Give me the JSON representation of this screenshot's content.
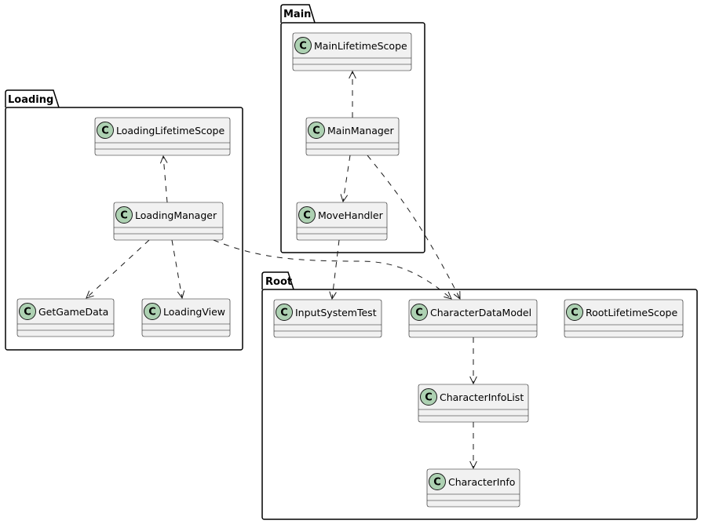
{
  "diagram": {
    "type": "uml-class-diagram",
    "packages": [
      {
        "id": "loading",
        "label": "Loading"
      },
      {
        "id": "main",
        "label": "Main"
      },
      {
        "id": "root",
        "label": "Root"
      }
    ],
    "classes": [
      {
        "id": "LoadingLifetimeScope",
        "label": "LoadingLifetimeScope",
        "package": "Loading",
        "stereotype_icon": "C"
      },
      {
        "id": "LoadingManager",
        "label": "LoadingManager",
        "package": "Loading",
        "stereotype_icon": "C"
      },
      {
        "id": "GetGameData",
        "label": "GetGameData",
        "package": "Loading",
        "stereotype_icon": "C"
      },
      {
        "id": "LoadingView",
        "label": "LoadingView",
        "package": "Loading",
        "stereotype_icon": "C"
      },
      {
        "id": "MainLifetimeScope",
        "label": "MainLifetimeScope",
        "package": "Main",
        "stereotype_icon": "C"
      },
      {
        "id": "MainManager",
        "label": "MainManager",
        "package": "Main",
        "stereotype_icon": "C"
      },
      {
        "id": "MoveHandler",
        "label": "MoveHandler",
        "package": "Main",
        "stereotype_icon": "C"
      },
      {
        "id": "InputSystemTest",
        "label": "InputSystemTest",
        "package": "Root",
        "stereotype_icon": "C"
      },
      {
        "id": "CharacterDataModel",
        "label": "CharacterDataModel",
        "package": "Root",
        "stereotype_icon": "C"
      },
      {
        "id": "RootLifetimeScope",
        "label": "RootLifetimeScope",
        "package": "Root",
        "stereotype_icon": "C"
      },
      {
        "id": "CharacterInfoList",
        "label": "CharacterInfoList",
        "package": "Root",
        "stereotype_icon": "C"
      },
      {
        "id": "CharacterInfo",
        "label": "CharacterInfo",
        "package": "Root",
        "stereotype_icon": "C"
      }
    ],
    "dependencies": [
      {
        "from": "LoadingManager",
        "to": "LoadingLifetimeScope",
        "style": "dashed"
      },
      {
        "from": "LoadingManager",
        "to": "GetGameData",
        "style": "dashed"
      },
      {
        "from": "LoadingManager",
        "to": "LoadingView",
        "style": "dashed"
      },
      {
        "from": "LoadingManager",
        "to": "CharacterDataModel",
        "style": "dashed"
      },
      {
        "from": "MainManager",
        "to": "MainLifetimeScope",
        "style": "dashed"
      },
      {
        "from": "MainManager",
        "to": "MoveHandler",
        "style": "dashed"
      },
      {
        "from": "MainManager",
        "to": "CharacterDataModel",
        "style": "dashed"
      },
      {
        "from": "MoveHandler",
        "to": "InputSystemTest",
        "style": "dashed"
      },
      {
        "from": "CharacterDataModel",
        "to": "CharacterInfoList",
        "style": "dashed"
      },
      {
        "from": "CharacterInfoList",
        "to": "CharacterInfo",
        "style": "dashed"
      }
    ]
  },
  "colors": {
    "class_fill": "#f1f1f1",
    "class_icon": "#add1b2",
    "stroke": "#181818"
  }
}
